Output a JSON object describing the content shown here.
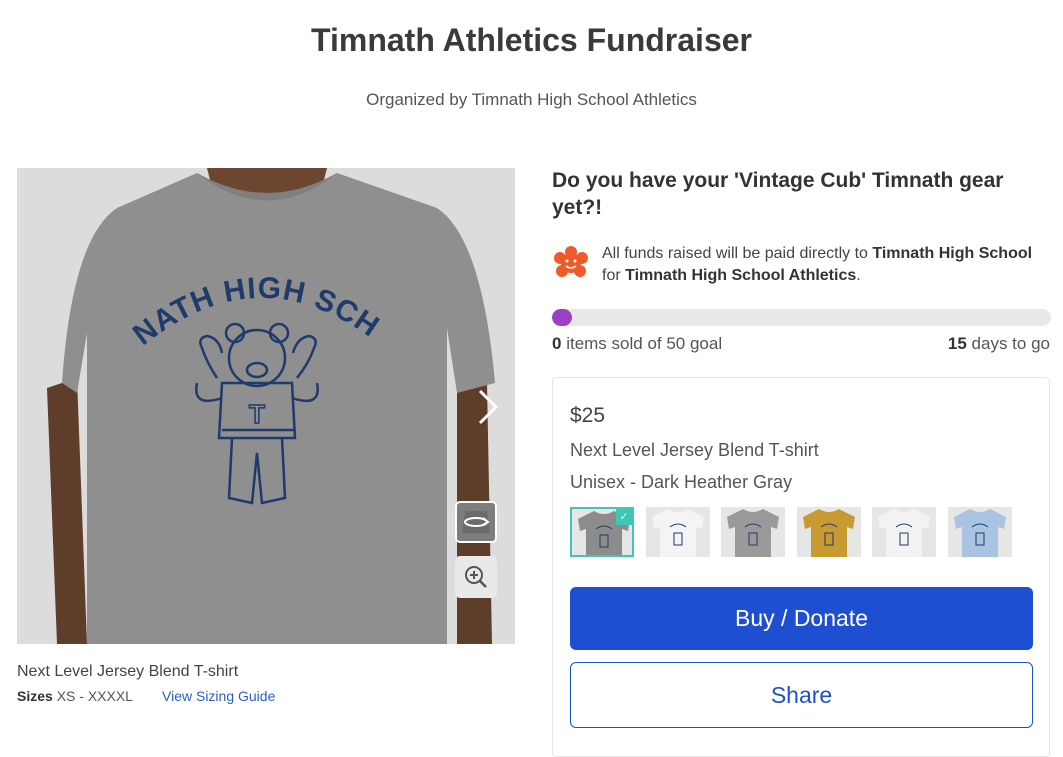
{
  "page": {
    "title": "Timnath Athletics Fundraiser",
    "organizer": "Organized by Timnath High School Athletics"
  },
  "product_image": {
    "print_text": "TIMNATH HIGH SCHOOL",
    "print_letter": "T",
    "shirt_color": "#8f8f8f",
    "print_color": "#1f3a6b",
    "icons": [
      "chevron-right-icon",
      "rotate-view-icon",
      "zoom-in-icon"
    ]
  },
  "caption": {
    "name": "Next Level Jersey Blend T-shirt",
    "sizes_label": "Sizes",
    "sizes_value": "XS - XXXXL",
    "sizing_guide": "View Sizing Guide"
  },
  "campaign": {
    "headline": "Do you have your 'Vintage Cub' Timnath gear yet?!",
    "funds_prefix": "All funds raised will be paid directly to ",
    "funds_recipient": "Timnath High School",
    "funds_middle": " for ",
    "funds_beneficiary": "Timnath High School Athletics",
    "funds_suffix": "."
  },
  "progress": {
    "sold": "0",
    "sold_label": " items sold of 50 goal",
    "fill_fraction": 0.04,
    "days": "15",
    "days_label": " days to go",
    "fill_color": "#9b3fc4"
  },
  "product": {
    "price": "$25",
    "name": "Next Level Jersey Blend T-shirt",
    "variant": "Unisex - Dark Heather Gray",
    "swatches": [
      {
        "color": "Dark Heather Gray",
        "hex": "#8c8c8c",
        "selected": true
      },
      {
        "color": "White",
        "hex": "#f4f4f4",
        "selected": false
      },
      {
        "color": "Gray",
        "hex": "#9a9a9a",
        "selected": false
      },
      {
        "color": "Gold",
        "hex": "#c79a32",
        "selected": false
      },
      {
        "color": "White Long Sleeve",
        "hex": "#f2f2f2",
        "selected": false
      },
      {
        "color": "Light Blue",
        "hex": "#a9c3e2",
        "selected": false
      }
    ]
  },
  "actions": {
    "buy": "Buy / Donate",
    "share": "Share"
  },
  "colors": {
    "primary": "#1f4fd1",
    "accent": "#3fc6b5",
    "brand_icon": "#f05a28"
  }
}
